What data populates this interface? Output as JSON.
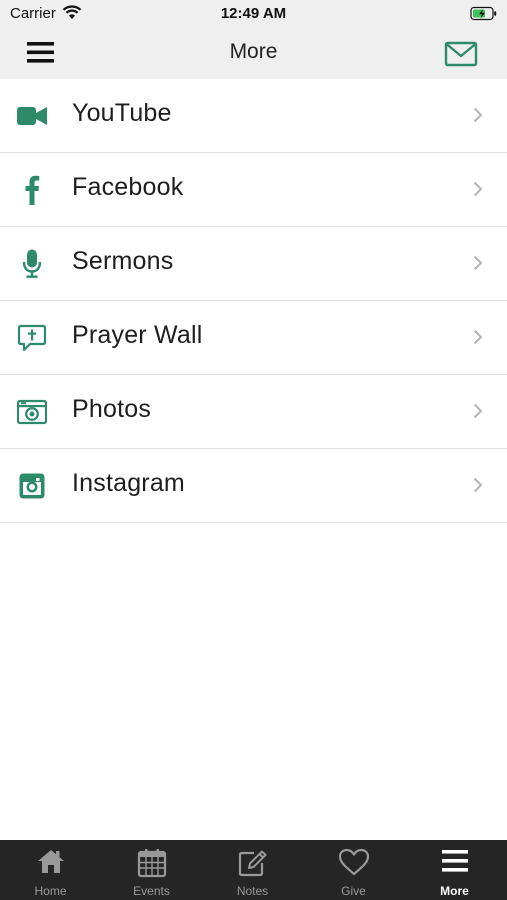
{
  "status_bar": {
    "carrier": "Carrier",
    "time": "12:49 AM"
  },
  "header": {
    "title": "More"
  },
  "colors": {
    "accent": "#2e8b6a",
    "tab_bar": "#252525",
    "tab_inactive": "#9a9a9a"
  },
  "menu": {
    "items": [
      {
        "label": "YouTube",
        "icon": "video-camera-icon"
      },
      {
        "label": "Facebook",
        "icon": "facebook-icon"
      },
      {
        "label": "Sermons",
        "icon": "microphone-icon"
      },
      {
        "label": "Prayer Wall",
        "icon": "prayer-bubble-icon"
      },
      {
        "label": "Photos",
        "icon": "camera-icon"
      },
      {
        "label": "Instagram",
        "icon": "instagram-icon"
      }
    ]
  },
  "tabs": [
    {
      "label": "Home",
      "icon": "home-icon"
    },
    {
      "label": "Events",
      "icon": "calendar-icon"
    },
    {
      "label": "Notes",
      "icon": "notes-edit-icon"
    },
    {
      "label": "Give",
      "icon": "heart-icon"
    },
    {
      "label": "More",
      "icon": "more-menu-icon",
      "active": true
    }
  ]
}
